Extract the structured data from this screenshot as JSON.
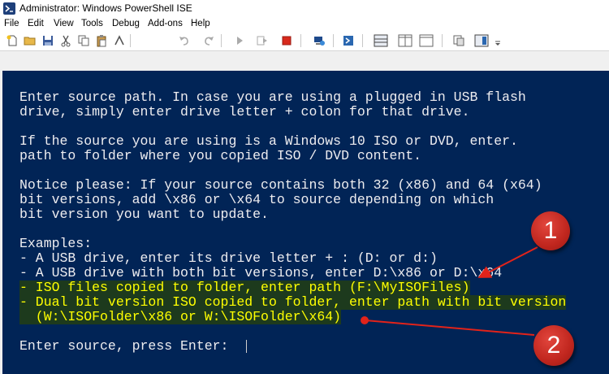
{
  "window": {
    "title": "Administrator: Windows PowerShell ISE"
  },
  "menu": {
    "items": [
      "File",
      "Edit",
      "View",
      "Tools",
      "Debug",
      "Add-ons",
      "Help"
    ]
  },
  "toolbar": {
    "buttons": [
      "new-script-icon",
      "open-icon",
      "save-icon",
      "cut-icon",
      "copy-icon",
      "paste-icon",
      "clear-icon",
      "undo-icon",
      "redo-icon",
      "run-icon",
      "run-selection-icon",
      "stop-icon",
      "remote-powershell-icon",
      "start-powershell-icon",
      "show-script-pane-top-icon",
      "show-script-pane-right-icon",
      "show-script-pane-max-icon",
      "show-command-window-icon",
      "show-command-addon-icon",
      "toolbar-overflow-icon"
    ]
  },
  "console": {
    "lines": [
      "Enter source path. In case you are using a plugged in USB flash",
      "drive, simply enter drive letter + colon for that drive.",
      "",
      "If the source you are using is a Windows 10 ISO or DVD, enter.",
      "path to folder where you copied ISO / DVD content.",
      "",
      "Notice please: If your source contains both 32 (x86) and 64 (x64)",
      "bit versions, add \\x86 or \\x64 to source depending on which",
      "bit version you want to update.",
      "",
      "Examples:",
      "- A USB drive, enter its drive letter + : (D: or d:)",
      "- A USB drive with both bit versions, enter D:\\x86 or D:\\x64",
      "- ISO files copied to folder, enter path (F:\\MyISOFiles)",
      "- Dual bit version ISO copied to folder, enter path with bit version",
      "  (W:\\ISOFolder\\x86 or W:\\ISOFolder\\x64)",
      "",
      "Enter source, press Enter: "
    ],
    "highlighted_lines": [
      13,
      14,
      15
    ],
    "colors": {
      "background": "#012456",
      "text": "#eeedf0",
      "highlight_text": "#ffff00",
      "highlight_bg": "#1d3a1d"
    }
  },
  "callouts": [
    "1",
    "2"
  ],
  "colors": {
    "callout": "#c0261e",
    "arrow": "#e2231a"
  }
}
